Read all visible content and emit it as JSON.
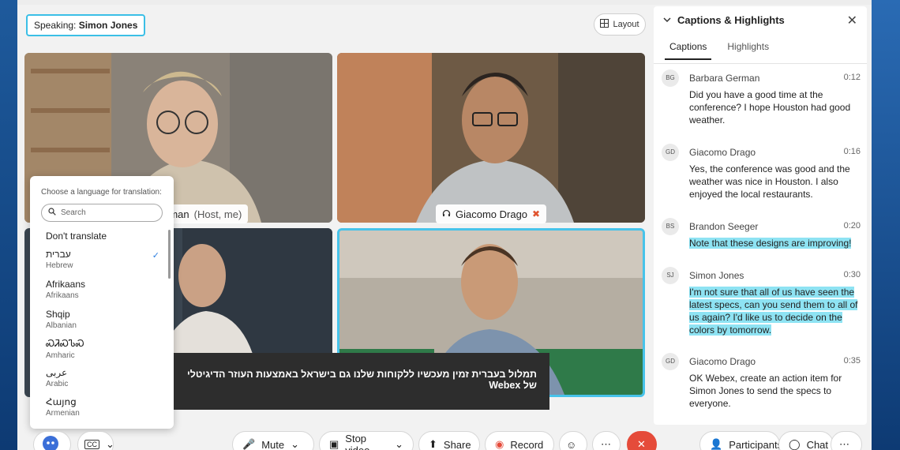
{
  "speaking": {
    "prefix": "Speaking:",
    "name": "Simon Jones"
  },
  "layout_button": "Layout",
  "tiles": [
    {
      "label": "rman",
      "suffix": "(Host, me)"
    },
    {
      "label": "Giacomo Drago"
    }
  ],
  "translation": {
    "title": "Choose a language for translation:",
    "search_placeholder": "Search",
    "dont_translate": "Don't translate",
    "languages": [
      {
        "native": "עברית",
        "english": "Hebrew",
        "selected": true
      },
      {
        "native": "Afrikaans",
        "english": "Afrikaans"
      },
      {
        "native": "Shqip",
        "english": "Albanian"
      },
      {
        "native": "ᏍᏘᏍᏖᏍ",
        "english": "Amharic"
      },
      {
        "native": "عربى",
        "english": "Arabic"
      },
      {
        "native": "Հայոց",
        "english": "Armenian"
      }
    ]
  },
  "caption_overlay": "תמלול בעברית זמין מעכשיו ללקוחות שלנו גם בישראל באמצעות העוזר הדיגיטלי של  Webex",
  "panel": {
    "title": "Captions & Highlights",
    "tabs": [
      "Captions",
      "Highlights"
    ],
    "entries": [
      {
        "initials": "BG",
        "name": "Barbara German",
        "time": "0:12",
        "text": "Did you have a good time at the conference? I hope Houston had good weather.",
        "highlight": false
      },
      {
        "initials": "GD",
        "name": "Giacomo Drago",
        "time": "0:16",
        "text": "Yes, the conference was good and the weather was nice in Houston. I also enjoyed the local restaurants.",
        "highlight": false
      },
      {
        "initials": "BS",
        "name": "Brandon Seeger",
        "time": "0:20",
        "text": "Note that these designs are improving!",
        "highlight": true
      },
      {
        "initials": "SJ",
        "name": "Simon Jones",
        "time": "0:30",
        "text": "I'm not sure that all of us have seen the latest specs, can you send them to all of us again? I'd like us to decide on the colors by tomorrow.",
        "highlight": true
      },
      {
        "initials": "GD",
        "name": "Giacomo Drago",
        "time": "0:35",
        "text": "OK Webex, create an action item for Simon Jones to send the specs to everyone.",
        "highlight": false
      }
    ]
  },
  "toolbar": {
    "mute": "Mute",
    "stop_video": "Stop video",
    "share": "Share",
    "record": "Record",
    "participants": "Participants",
    "chat": "Chat"
  },
  "colors": {
    "accent": "#47c3ea",
    "highlight": "#8ee3f3",
    "end": "#e54b3a"
  }
}
